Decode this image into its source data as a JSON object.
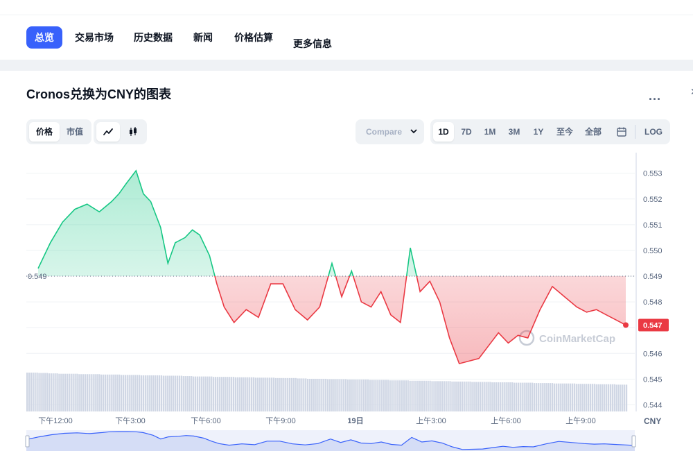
{
  "nav": {
    "tabs": [
      "总览",
      "交易市场",
      "历史数据",
      "新闻",
      "价格估算",
      "更多信息"
    ],
    "active": "总览"
  },
  "chart_title": "Cronos兑换为CNY的图表",
  "more_label": "...",
  "controls": {
    "metric": [
      "价格",
      "市值"
    ],
    "metric_active": "价格",
    "chart_style": [
      "line-chart-icon",
      "candlestick-icon"
    ],
    "compare_label": "Compare",
    "ranges": [
      "1D",
      "7D",
      "1M",
      "3M",
      "1Y",
      "至今",
      "全部"
    ],
    "range_active": "1D",
    "calendar_icon": "calendar-icon",
    "log_label": "LOG"
  },
  "colors": {
    "up": "#16c784",
    "down": "#ea3943",
    "accent": "#3861fb"
  },
  "chart_data": {
    "type": "line",
    "title": "Cronos兑换为CNY的图表",
    "currency": "CNY",
    "y_ticks": [
      "0.553",
      "0.552",
      "0.551",
      "0.550",
      "0.549",
      "0.548",
      "0.547",
      "0.546",
      "0.545",
      "0.544"
    ],
    "ylim": [
      0.5435,
      0.5538
    ],
    "reference_price": "0.549",
    "current_price": "0.547",
    "x_ticks": [
      "下午12:00",
      "下午3:00",
      "下午6:00",
      "下午9:00",
      "19日",
      "上午3:00",
      "上午6:00",
      "上午9:00"
    ],
    "watermark": "CoinMarketCap",
    "x_hours": [
      0,
      0.5,
      1,
      1.5,
      2,
      2.5,
      3,
      3.3,
      3.6,
      4,
      4.3,
      4.6,
      5,
      5.3,
      5.6,
      6,
      6.3,
      6.6,
      7,
      7.3,
      7.6,
      8,
      8.5,
      9,
      9.5,
      10,
      10.5,
      11,
      11.5,
      12,
      12.4,
      12.8,
      13.2,
      13.6,
      14,
      14.4,
      14.8,
      15.2,
      15.6,
      16,
      16.4,
      16.8,
      17.2,
      17.6,
      18,
      18.4,
      18.8,
      19.2,
      19.6,
      20,
      20.5,
      21,
      21.5,
      22,
      22.4,
      22.8,
      23.2,
      23.6,
      24
    ],
    "values": [
      0.5493,
      0.5503,
      0.5511,
      0.5516,
      0.5518,
      0.5515,
      0.5519,
      0.5522,
      0.5526,
      0.5531,
      0.5522,
      0.5519,
      0.5509,
      0.5495,
      0.5503,
      0.5505,
      0.5508,
      0.5506,
      0.5498,
      0.5487,
      0.5478,
      0.5472,
      0.5477,
      0.5474,
      0.5487,
      0.5487,
      0.5477,
      0.5473,
      0.5478,
      0.5495,
      0.5482,
      0.5492,
      0.548,
      0.5478,
      0.5484,
      0.5475,
      0.5472,
      0.5501,
      0.5484,
      0.5488,
      0.548,
      0.5466,
      0.5456,
      0.5457,
      0.5458,
      0.5463,
      0.5468,
      0.5464,
      0.5467,
      0.5466,
      0.5477,
      0.5486,
      0.5482,
      0.5478,
      0.5476,
      0.5477,
      0.5475,
      0.5473,
      0.5471
    ],
    "volume_relative": [
      1.0,
      0.99,
      0.98,
      0.97,
      0.97,
      0.96,
      0.96,
      0.95,
      0.95,
      0.94,
      0.94,
      0.93,
      0.93,
      0.92,
      0.92,
      0.91,
      0.9,
      0.9,
      0.89,
      0.89,
      0.88,
      0.88,
      0.87,
      0.87,
      0.86,
      0.86,
      0.85,
      0.84,
      0.84,
      0.83,
      0.83,
      0.82,
      0.82,
      0.81,
      0.81,
      0.8,
      0.8,
      0.79,
      0.79,
      0.78,
      0.78,
      0.77,
      0.77,
      0.76,
      0.76,
      0.75,
      0.75,
      0.74,
      0.74,
      0.73,
      0.73,
      0.72,
      0.72,
      0.71,
      0.71,
      0.7,
      0.7,
      0.69,
      0.69
    ]
  }
}
